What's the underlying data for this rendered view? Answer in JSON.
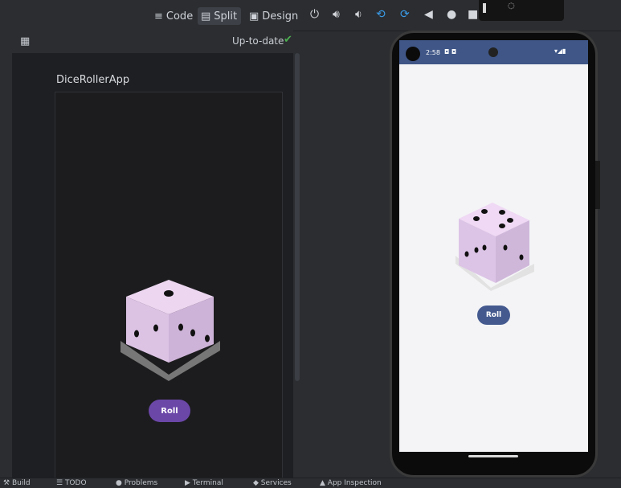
{
  "toolbar": {
    "code_label": "Code",
    "split_label": "Split",
    "design_label": "Design",
    "code_icon": "lines-icon",
    "split_icon": "split-icon",
    "design_icon": "image-icon"
  },
  "emulator_controls": {
    "icons": [
      "power-icon",
      "volume-up-icon",
      "volume-down-icon",
      "rotate-left-icon",
      "rotate-right-icon",
      "back-icon",
      "home-icon",
      "overview-icon"
    ]
  },
  "preview": {
    "status_text": "Up-to-date",
    "status_color": "#4caf50",
    "app_title": "DiceRollerApp",
    "roll_label": "Roll",
    "dice_top_face": 1,
    "dice_left_face": 2,
    "dice_right_face": 3
  },
  "device": {
    "time": "2:58",
    "roll_label": "Roll",
    "dice_top_face": 5,
    "dice_left_face": 3,
    "dice_right_face": 2
  },
  "bottom_bar": {
    "items": [
      "Build",
      "TODO",
      "Problems",
      "Terminal",
      "Services",
      "App Inspection"
    ]
  },
  "colors": {
    "accent_purple": "#6b47a8",
    "accent_blue": "#445a8f",
    "status_bar": "#3f5687"
  }
}
